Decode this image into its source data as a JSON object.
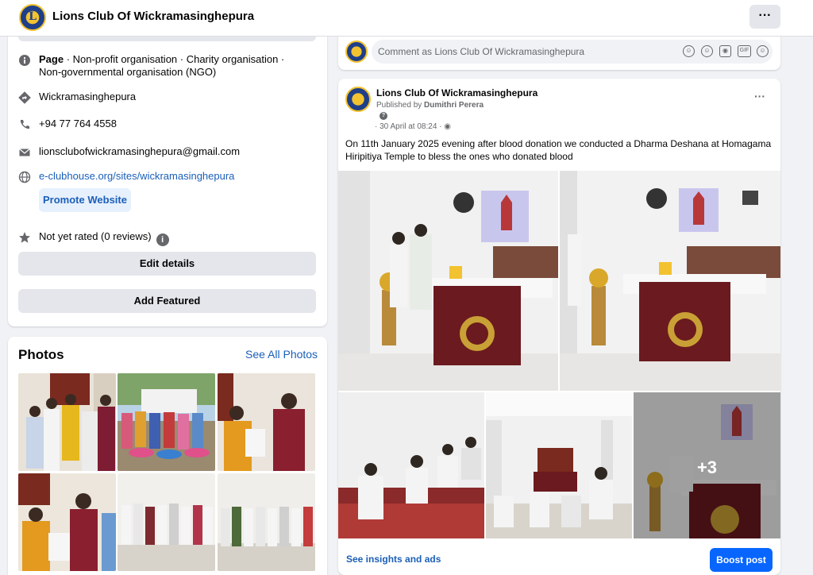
{
  "header": {
    "page_name": "Lions Club Of Wickramasinghepura",
    "more_label": "···"
  },
  "intro": {
    "category_prefix": "Page",
    "category_text": " · Non-profit organisation · Charity organisation · Non-governmental organisation (NGO)",
    "location": "Wickramasinghepura",
    "phone": "+94 77 764 4558",
    "email": "lionsclubofwickramasinghepura@gmail.com",
    "website": "e-clubhouse.org/sites/wickramasinghepura",
    "promote_label": "Promote Website",
    "rating": "Not yet rated (0 reviews)",
    "rating_info_icon": "i",
    "edit_details_label": "Edit details",
    "add_featured_label": "Add Featured"
  },
  "photos": {
    "title": "Photos",
    "see_all_label": "See All Photos"
  },
  "comment": {
    "placeholder": "Comment as Lions Club Of Wickramasinghepura"
  },
  "post": {
    "author": "Lions Club Of Wickramasinghepura",
    "published_by_prefix": "Published by ",
    "published_by_name": "Dumithri Perera",
    "date": "· 30 April at 08:24 ·",
    "text": "On 11th January 2025 evening after blood donation we conducted a Dharma Deshana at Homagama Hiripitiya Temple to bless the ones who donated blood",
    "more_photos_count": "+3",
    "insights_label": "See insights and ads",
    "boost_label": "Boost post",
    "menu_label": "···"
  },
  "colors": {
    "accent_blue": "#0866ff",
    "link_blue": "#1b5fb8",
    "banner_maroon": "#6b1a1f",
    "logo_gold": "#f2c230",
    "logo_navy": "#1f3f88"
  }
}
